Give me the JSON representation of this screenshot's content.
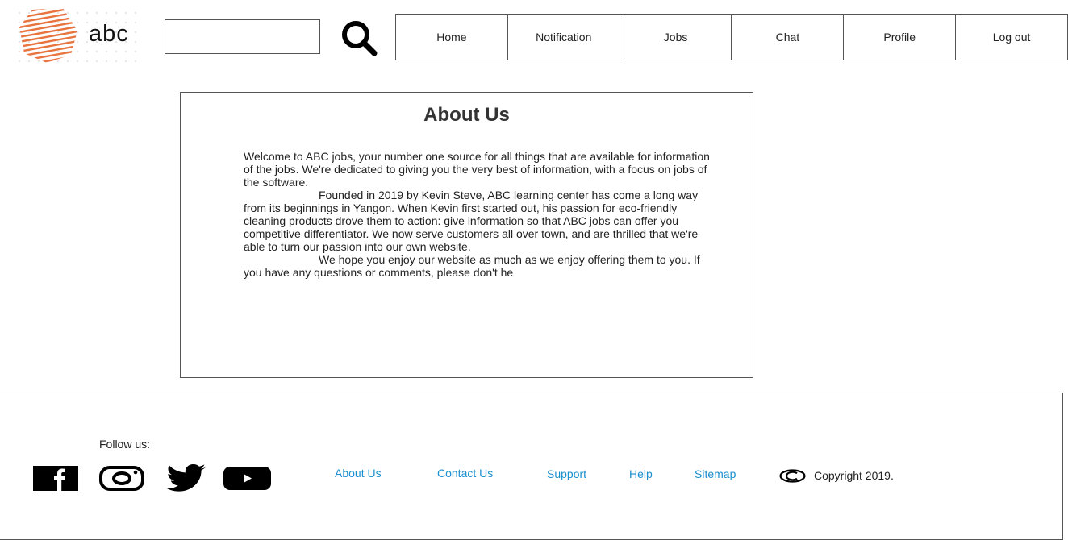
{
  "logo": {
    "text": "abc"
  },
  "search": {
    "placeholder": "",
    "value": ""
  },
  "nav": {
    "items": [
      {
        "label": "Home"
      },
      {
        "label": "Notification"
      },
      {
        "label": "Jobs"
      },
      {
        "label": "Chat"
      },
      {
        "label": "Profile"
      },
      {
        "label": "Log out"
      }
    ]
  },
  "about": {
    "title": "About Us",
    "paragraphs": [
      "Welcome to ABC jobs, your number one source for all things that are available for information of the jobs. We're dedicated to giving you the very best of information, with a focus on jobs of the software.",
      "Founded in 2019 by Kevin Steve, ABC learning center has come a long way from its beginnings in Yangon. When Kevin first started out, his passion for eco-friendly cleaning products drove them to action: give information so that ABC jobs can offer you competitive differentiator. We now serve customers all over town, and are thrilled that we're able to turn our passion into our own website.",
      "We hope you enjoy our website as much as we enjoy offering them to you. If you have any questions or comments, please don't he"
    ]
  },
  "footer": {
    "follow_label": "Follow us:",
    "social": [
      "facebook-icon",
      "instagram-icon",
      "twitter-icon",
      "youtube-icon"
    ],
    "links": [
      {
        "label": "About Us"
      },
      {
        "label": "Contact Us"
      },
      {
        "label": "Support"
      },
      {
        "label": "Help"
      },
      {
        "label": "Sitemap"
      }
    ],
    "copyright": "Copyright 2019."
  },
  "colors": {
    "link": "#1a8fce",
    "logo_orange": "#e8743f",
    "border": "#555555"
  }
}
